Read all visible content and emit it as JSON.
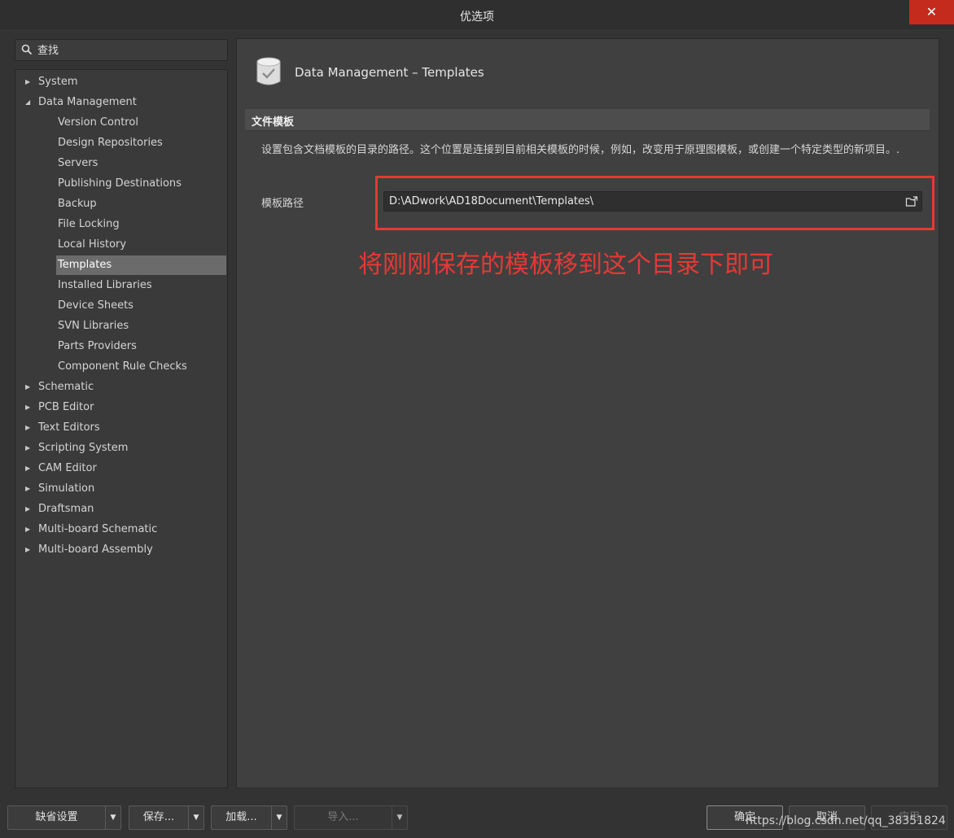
{
  "window": {
    "title": "优选项",
    "close_label": "✕"
  },
  "search": {
    "placeholder": "查找"
  },
  "tree": {
    "items": [
      {
        "label": "System",
        "level": 0,
        "arrow": "▶"
      },
      {
        "label": "Data Management",
        "level": 0,
        "arrow": "◢"
      },
      {
        "label": "Version Control",
        "level": 1
      },
      {
        "label": "Design Repositories",
        "level": 1
      },
      {
        "label": "Servers",
        "level": 1
      },
      {
        "label": "Publishing Destinations",
        "level": 1
      },
      {
        "label": "Backup",
        "level": 1
      },
      {
        "label": "File Locking",
        "level": 1
      },
      {
        "label": "Local History",
        "level": 1
      },
      {
        "label": "Templates",
        "level": 1,
        "selected": true
      },
      {
        "label": "Installed Libraries",
        "level": 1
      },
      {
        "label": "Device Sheets",
        "level": 1
      },
      {
        "label": "SVN Libraries",
        "level": 1
      },
      {
        "label": "Parts Providers",
        "level": 1
      },
      {
        "label": "Component Rule Checks",
        "level": 1
      },
      {
        "label": "Schematic",
        "level": 0,
        "arrow": "▶"
      },
      {
        "label": "PCB Editor",
        "level": 0,
        "arrow": "▶"
      },
      {
        "label": "Text Editors",
        "level": 0,
        "arrow": "▶"
      },
      {
        "label": "Scripting System",
        "level": 0,
        "arrow": "▶"
      },
      {
        "label": "CAM Editor",
        "level": 0,
        "arrow": "▶"
      },
      {
        "label": "Simulation",
        "level": 0,
        "arrow": "▶"
      },
      {
        "label": "Draftsman",
        "level": 0,
        "arrow": "▶"
      },
      {
        "label": "Multi-board Schematic",
        "level": 0,
        "arrow": "▶"
      },
      {
        "label": "Multi-board Assembly",
        "level": 0,
        "arrow": "▶"
      }
    ]
  },
  "content": {
    "title": "Data Management – Templates",
    "section_title": "文件模板",
    "description": "设置包含文档模板的目录的路径。这个位置是连接到目前相关模板的时候，例如，改变用于原理图模板，或创建一个特定类型的新项目。.",
    "path_label": "模板路径",
    "path_value": "D:\\ADwork\\AD18Document\\Templates\\",
    "annotation": "将刚刚保存的模板移到这个目录下即可"
  },
  "footer": {
    "defaults_label": "缺省设置",
    "save_label": "保存...",
    "load_label": "加载...",
    "import_label": "导入...",
    "dropdown_glyph": "▼",
    "ok_label": "确定",
    "cancel_label": "取消",
    "apply_label": "应用",
    "watermark": "https://blog.csdn.net/qq_38351824"
  },
  "colors": {
    "annotation": "#e53935",
    "selected_row": "#6b6b6b",
    "close_button": "#c42b1c"
  }
}
